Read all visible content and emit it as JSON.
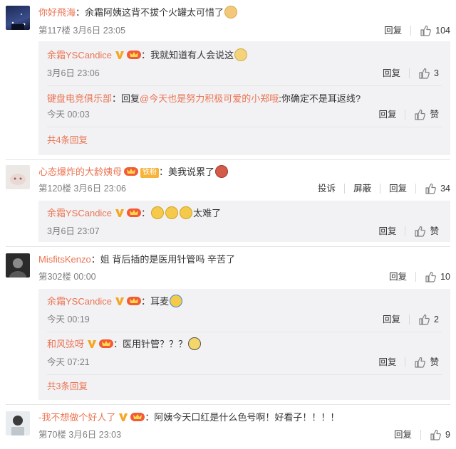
{
  "comments": [
    {
      "user": "你好飛海",
      "text": "余霜阿姨这背不拔个火罐太可惜了",
      "meta": "第117楼 3月6日 23:05",
      "reply_label": "回复",
      "likes": "104",
      "replies": [
        {
          "user": "余霜YSCandice",
          "text": "我就知道有人会说这",
          "meta": "3月6日 23:06",
          "reply_label": "回复",
          "likes": "3"
        },
        {
          "user": "键盘电竞俱乐部",
          "text_prefix": "回复",
          "mention": "@今天也是努力积极可爱的小郑哦",
          "text": ":你确定不是耳返线?",
          "meta": "今天 00:03",
          "reply_label": "回复",
          "likes": "赞"
        }
      ],
      "more": "共4条回复"
    },
    {
      "user": "心态爆炸的大龄姨母",
      "badge": "铁粉",
      "text": "美我说累了",
      "meta": "第120楼 3月6日 23:06",
      "report_label": "投诉",
      "block_label": "屏蔽",
      "reply_label": "回复",
      "likes": "34",
      "replies": [
        {
          "user": "余霜YSCandice",
          "text": "太难了",
          "meta": "3月6日 23:07",
          "reply_label": "回复",
          "likes": "赞"
        }
      ]
    },
    {
      "user": "MisfitsKenzo",
      "text": "姐 背后插的是医用针管吗 辛苦了",
      "meta": "第302楼 00:00",
      "reply_label": "回复",
      "likes": "10",
      "replies": [
        {
          "user": "余霜YSCandice",
          "text": "耳麦",
          "meta": "今天 00:19",
          "reply_label": "回复",
          "likes": "2"
        },
        {
          "user": "和风弦呀",
          "text": "医用针管？？？",
          "meta": "今天 07:21",
          "reply_label": "回复",
          "likes": "赞"
        }
      ],
      "more": "共3条回复"
    },
    {
      "user": "-我不想做个好人了",
      "text": "阿姨今天口红是什么色号啊！好看子！！！！",
      "meta": "第70楼 3月6日 23:03",
      "reply_label": "回复",
      "likes": "9"
    }
  ],
  "colors": {
    "accent": "#eb7350",
    "meta": "#808080",
    "reply_bg": "#f2f2f5",
    "badge": "#f7b33a"
  }
}
